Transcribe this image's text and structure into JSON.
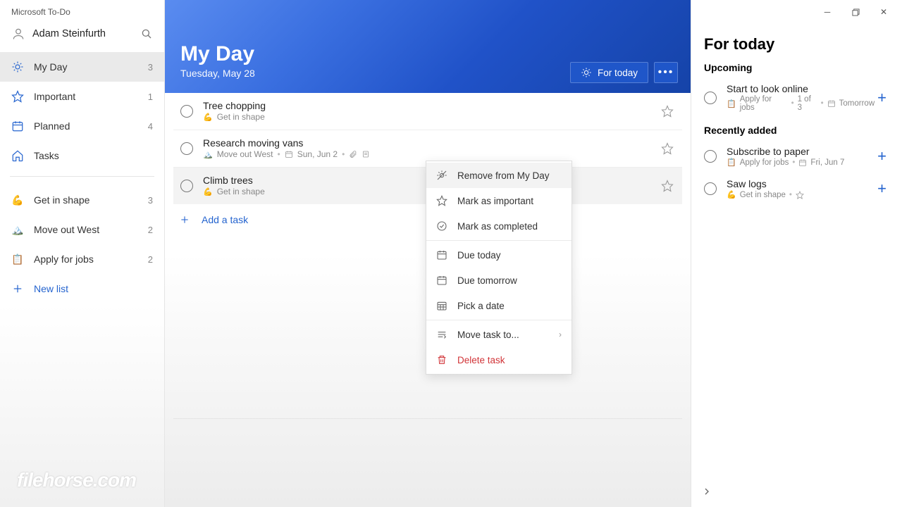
{
  "app_title": "Microsoft To-Do",
  "user": {
    "name": "Adam Steinfurth"
  },
  "sidebar": {
    "smart_lists": [
      {
        "label": "My Day",
        "count": "3",
        "icon": "sun",
        "color": "#2564cf",
        "active": true
      },
      {
        "label": "Important",
        "count": "1",
        "icon": "star",
        "color": "#2564cf",
        "active": false
      },
      {
        "label": "Planned",
        "count": "4",
        "icon": "calendar",
        "color": "#2564cf",
        "active": false
      },
      {
        "label": "Tasks",
        "count": "",
        "icon": "home",
        "color": "#2564cf",
        "active": false
      }
    ],
    "custom_lists": [
      {
        "label": "Get in shape",
        "count": "3",
        "emoji": "💪"
      },
      {
        "label": "Move out West",
        "count": "2",
        "emoji": "🏔️"
      },
      {
        "label": "Apply for jobs",
        "count": "2",
        "emoji": "📋"
      }
    ],
    "new_list_label": "New list"
  },
  "hero": {
    "title": "My Day",
    "date": "Tuesday, May 28",
    "for_today_label": "For today"
  },
  "tasks": [
    {
      "title": "Tree chopping",
      "list_emoji": "💪",
      "list_label": "Get in shape",
      "extras": []
    },
    {
      "title": "Research moving vans",
      "list_emoji": "🏔️",
      "list_label": "Move out West",
      "extras": [
        "date:Sun, Jun 2",
        "attach",
        "note"
      ]
    },
    {
      "title": "Climb trees",
      "list_emoji": "💪",
      "list_label": "Get in shape",
      "extras": [],
      "selected": true
    }
  ],
  "add_task_label": "Add a task",
  "context_menu": {
    "items": [
      {
        "label": "Remove from My Day",
        "icon": "sun-remove",
        "hover": true
      },
      {
        "label": "Mark as important",
        "icon": "star"
      },
      {
        "label": "Mark as completed",
        "icon": "check-circle"
      }
    ],
    "date_items": [
      {
        "label": "Due today",
        "icon": "calendar"
      },
      {
        "label": "Due tomorrow",
        "icon": "calendar"
      },
      {
        "label": "Pick a date",
        "icon": "calendar-grid"
      }
    ],
    "footer_items": [
      {
        "label": "Move task to...",
        "icon": "move",
        "submenu": true
      },
      {
        "label": "Delete task",
        "icon": "trash",
        "danger": true
      }
    ]
  },
  "right_panel": {
    "title": "For today",
    "sections": [
      {
        "heading": "Upcoming",
        "items": [
          {
            "label": "Start to look online",
            "list_emoji": "📋",
            "list_label": "Apply for jobs",
            "meta2": "1 of 3",
            "meta3_icon": "calendar",
            "meta3": "Tomorrow"
          }
        ]
      },
      {
        "heading": "Recently added",
        "items": [
          {
            "label": "Subscribe to paper",
            "list_emoji": "📋",
            "list_label": "Apply for jobs",
            "meta3_icon": "calendar",
            "meta3": "Fri, Jun 7"
          },
          {
            "label": "Saw logs",
            "list_emoji": "💪",
            "list_label": "Get in shape",
            "meta3_icon": "star",
            "meta3": ""
          }
        ]
      }
    ]
  },
  "watermark": "filehorse.com"
}
